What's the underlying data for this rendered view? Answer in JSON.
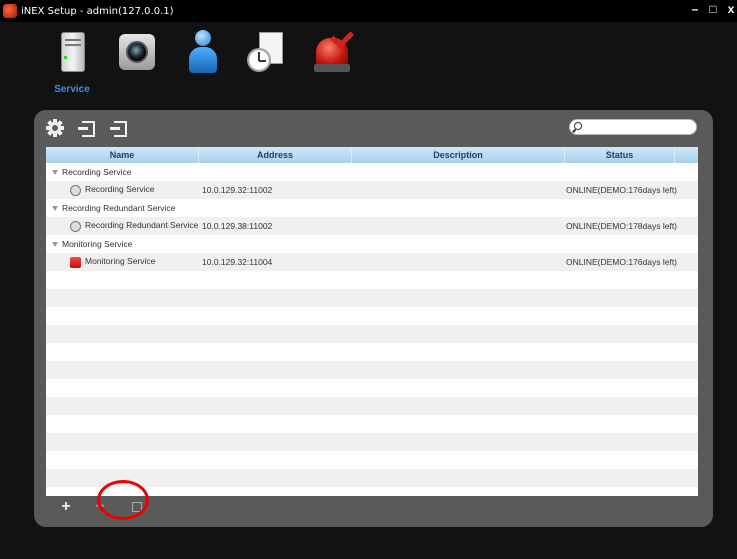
{
  "window": {
    "title": "iNEX Setup - admin(127.0.0.1)"
  },
  "toolbar": {
    "tools": [
      {
        "label": "Service",
        "icon": "server-icon"
      },
      {
        "label": "",
        "icon": "camera-icon"
      },
      {
        "label": "",
        "icon": "user-icon"
      },
      {
        "label": "",
        "icon": "schedule-icon"
      },
      {
        "label": "",
        "icon": "alarm-icon"
      }
    ]
  },
  "panel": {
    "toolbar_icons": [
      "gear-icon",
      "import-icon",
      "export-icon"
    ],
    "search": {
      "value": "",
      "placeholder": ""
    }
  },
  "table": {
    "columns": [
      "Name",
      "Address",
      "Description",
      "Status"
    ],
    "rows": [
      {
        "type": "group",
        "name": "Recording Service"
      },
      {
        "type": "item",
        "icon": "recording-service-icon",
        "name": "Recording Service",
        "address": "10.0.129.32:11002",
        "description": "",
        "status": "ONLINE(DEMO:176days left)"
      },
      {
        "type": "group",
        "name": "Recording Redundant Service"
      },
      {
        "type": "item",
        "icon": "recording-service-icon",
        "name": "Recording Redundant Service",
        "address": "10.0.129.38:11002",
        "description": "",
        "status": "ONLINE(DEMO:178days left)"
      },
      {
        "type": "group",
        "name": "Monitoring Service"
      },
      {
        "type": "item",
        "icon": "monitoring-service-icon",
        "name": "Monitoring Service",
        "address": "10.0.129.32:11004",
        "description": "",
        "status": "ONLINE(DEMO:176days left)"
      }
    ]
  },
  "bottom": {
    "add": "+",
    "remove": "−"
  },
  "colors": {
    "accent": "#3f8fe0",
    "panel": "#5a5a5a",
    "highlight": "#e00000"
  }
}
